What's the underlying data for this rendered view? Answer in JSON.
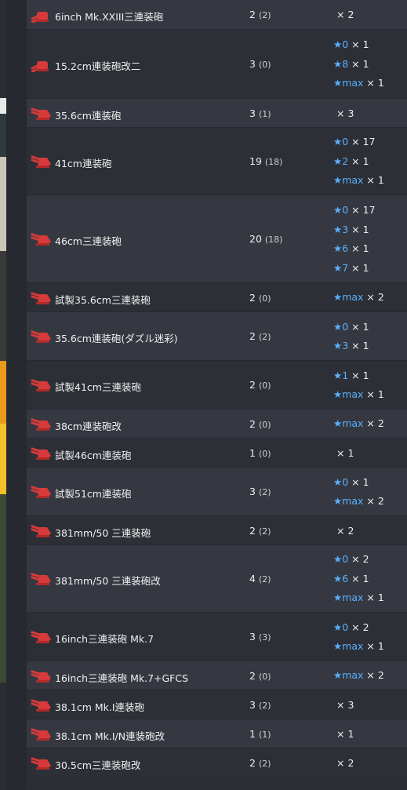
{
  "colors": {
    "accent_star": "#5ab0ff",
    "gun_red": "#d63a3a",
    "row_odd": "#353840",
    "row_even": "#2c2f36"
  },
  "rows": [
    {
      "icon": "main-gun-medium-icon",
      "name": "6inch Mk.XXIII三連装砲",
      "count": "2",
      "sub": "(2)",
      "stars": [],
      "plain": "× 2"
    },
    {
      "icon": "main-gun-medium-icon",
      "name": "15.2cm連装砲改二",
      "count": "3",
      "sub": "(0)",
      "stars": [
        {
          "lvl": "★0",
          "mult": " × 1"
        },
        {
          "lvl": "★8",
          "mult": " × 1"
        },
        {
          "lvl": "★max",
          "mult": " × 1"
        }
      ],
      "plain": ""
    },
    {
      "icon": "main-gun-large-icon",
      "name": "35.6cm連装砲",
      "count": "3",
      "sub": "(1)",
      "stars": [],
      "plain": "× 3"
    },
    {
      "icon": "main-gun-large-icon",
      "name": "41cm連装砲",
      "count": "19",
      "sub": "(18)",
      "stars": [
        {
          "lvl": "★0",
          "mult": " × 17"
        },
        {
          "lvl": "★2",
          "mult": " × 1"
        },
        {
          "lvl": "★max",
          "mult": " × 1"
        }
      ],
      "plain": ""
    },
    {
      "icon": "main-gun-large-icon",
      "name": "46cm三連装砲",
      "count": "20",
      "sub": "(18)",
      "stars": [
        {
          "lvl": "★0",
          "mult": " × 17"
        },
        {
          "lvl": "★3",
          "mult": " × 1"
        },
        {
          "lvl": "★6",
          "mult": " × 1"
        },
        {
          "lvl": "★7",
          "mult": " × 1"
        }
      ],
      "plain": ""
    },
    {
      "icon": "main-gun-large-icon",
      "name": "試製35.6cm三連装砲",
      "count": "2",
      "sub": "(0)",
      "stars": [
        {
          "lvl": "★max",
          "mult": " × 2"
        }
      ],
      "plain": ""
    },
    {
      "icon": "main-gun-large-icon",
      "name": "35.6cm連装砲(ダズル迷彩)",
      "count": "2",
      "sub": "(2)",
      "stars": [
        {
          "lvl": "★0",
          "mult": " × 1"
        },
        {
          "lvl": "★3",
          "mult": " × 1"
        }
      ],
      "plain": ""
    },
    {
      "icon": "main-gun-large-icon",
      "name": "試製41cm三連装砲",
      "count": "2",
      "sub": "(0)",
      "stars": [
        {
          "lvl": "★1",
          "mult": " × 1"
        },
        {
          "lvl": "★max",
          "mult": " × 1"
        }
      ],
      "plain": ""
    },
    {
      "icon": "main-gun-large-icon",
      "name": "38cm連装砲改",
      "count": "2",
      "sub": "(0)",
      "stars": [
        {
          "lvl": "★max",
          "mult": " × 2"
        }
      ],
      "plain": ""
    },
    {
      "icon": "main-gun-large-icon",
      "name": "試製46cm連装砲",
      "count": "1",
      "sub": "(0)",
      "stars": [],
      "plain": "× 1"
    },
    {
      "icon": "main-gun-large-icon",
      "name": "試製51cm連装砲",
      "count": "3",
      "sub": "(2)",
      "stars": [
        {
          "lvl": "★0",
          "mult": " × 1"
        },
        {
          "lvl": "★max",
          "mult": " × 2"
        }
      ],
      "plain": ""
    },
    {
      "icon": "main-gun-large-icon",
      "name": "381mm/50 三連装砲",
      "count": "2",
      "sub": "(2)",
      "stars": [],
      "plain": "× 2"
    },
    {
      "icon": "main-gun-large-icon",
      "name": "381mm/50 三連装砲改",
      "count": "4",
      "sub": "(2)",
      "stars": [
        {
          "lvl": "★0",
          "mult": " × 2"
        },
        {
          "lvl": "★6",
          "mult": " × 1"
        },
        {
          "lvl": "★max",
          "mult": " × 1"
        }
      ],
      "plain": ""
    },
    {
      "icon": "main-gun-large-icon",
      "name": "16inch三連装砲 Mk.7",
      "count": "3",
      "sub": "(3)",
      "stars": [
        {
          "lvl": "★0",
          "mult": " × 2"
        },
        {
          "lvl": "★max",
          "mult": " × 1"
        }
      ],
      "plain": ""
    },
    {
      "icon": "main-gun-large-icon",
      "name": "16inch三連装砲 Mk.7+GFCS",
      "count": "2",
      "sub": "(0)",
      "stars": [
        {
          "lvl": "★max",
          "mult": " × 2"
        }
      ],
      "plain": ""
    },
    {
      "icon": "main-gun-large-icon",
      "name": "38.1cm Mk.I連装砲",
      "count": "3",
      "sub": "(2)",
      "stars": [],
      "plain": "× 3"
    },
    {
      "icon": "main-gun-large-icon",
      "name": "38.1cm Mk.I/N連装砲改",
      "count": "1",
      "sub": "(1)",
      "stars": [],
      "plain": "× 1"
    },
    {
      "icon": "main-gun-large-icon",
      "name": "30.5cm三連装砲改",
      "count": "2",
      "sub": "(2)",
      "stars": [],
      "plain": "× 2"
    }
  ]
}
